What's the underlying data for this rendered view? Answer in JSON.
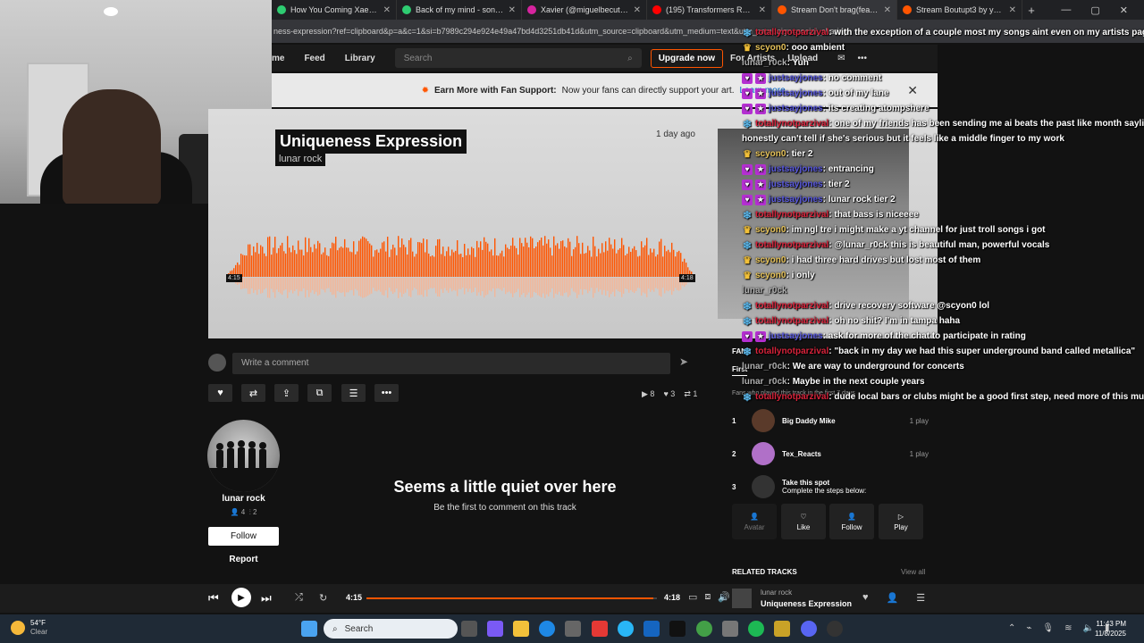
{
  "browser": {
    "tabs": [
      {
        "title": "How You Coming Xae? - so",
        "color": "#2ecc71"
      },
      {
        "title": "Back of my mind - song an",
        "color": "#2ecc71"
      },
      {
        "title": "Xavier (@miguelbecute) • In",
        "color": "#d6249f"
      },
      {
        "title": "(195) Transformers Reveng",
        "color": "#ff0000"
      },
      {
        "title": "Stream Don't brag(feat.DY",
        "color": "#ff5500"
      },
      {
        "title": "Stream Boutupt3 by young",
        "color": "#ff5500"
      }
    ],
    "new_tab": "+",
    "url": "ness-expression?ref=clipboard&p=a&c=1&si=b7989c294e924e49a47bd4d3251db41d&utm_source=clipboard&utm_medium=text&utm_campaign=social_sharing"
  },
  "site": {
    "nav": [
      "me",
      "Feed",
      "Library"
    ],
    "search_placeholder": "Search",
    "upgrade": "Upgrade now",
    "for_artists": "For Artists",
    "upload": "Upload",
    "banner_bold": "Earn More with Fan Support:",
    "banner_text": "Now your fans can directly support your art.",
    "banner_link": "Learn more."
  },
  "track": {
    "title": "Uniqueness Expression",
    "artist": "lunar rock",
    "posted": "1 day ago",
    "time_left": "4:15",
    "time_right": "4:18",
    "comment_placeholder": "Write a comment",
    "plays": "8",
    "likes": "3",
    "reposts": "1",
    "wave_color": "#ff5500"
  },
  "artist_panel": {
    "name": "lunar rock",
    "followers": "4",
    "tracks": "2",
    "follow": "Follow",
    "report": "Report"
  },
  "comments_empty": {
    "title": "Seems a little quiet over here",
    "subtitle": "Be the first to comment on this track"
  },
  "fans": {
    "title": "FANS",
    "tab": "First",
    "subtitle": "Fans who played this track in the first 7 days",
    "rows": [
      {
        "rank": "1",
        "name": "Big Daddy Mike",
        "plays": "1 play"
      },
      {
        "rank": "2",
        "name": "Tex_Reacts",
        "plays": "1 play"
      },
      {
        "rank": "3",
        "name": "Take this spot",
        "sub": "Complete the steps below:"
      }
    ],
    "spot_buttons": [
      "Avatar",
      "Like",
      "Follow",
      "Play"
    ],
    "related": "RELATED TRACKS",
    "view_all": "View all"
  },
  "chat": [
    {
      "badges": [
        "snow"
      ],
      "user": "totallynotparzival",
      "ucolor": "red",
      "msg": ": with the exception of a couple most my songs aint even on my artists pages"
    },
    {
      "badges": [
        "crown"
      ],
      "user": "scyon0",
      "ucolor": "gold",
      "msg": ": ooo ambient"
    },
    {
      "badges": [],
      "user": "lunar_r0ck",
      "ucolor": "grey",
      "msg": ": Yuh"
    },
    {
      "badges": [
        "heart",
        "star"
      ],
      "user": "justsayjones",
      "ucolor": "blue",
      "msg": ": no comment"
    },
    {
      "badges": [
        "heart",
        "star"
      ],
      "user": "justsayjones",
      "ucolor": "blue",
      "msg": ": out of my lane"
    },
    {
      "badges": [
        "heart",
        "star"
      ],
      "user": "justsayjones",
      "ucolor": "blue",
      "msg": ": its creating atompshere"
    },
    {
      "badges": [
        "snow"
      ],
      "user": "totallynotparzival",
      "ucolor": "red",
      "msg": ": one of my friends has been sending me ai beats the past like month sayling"
    },
    {
      "badges": [],
      "user": "",
      "ucolor": "grey",
      "msg": "honestly can't tell if she's serious but it feels like a middle finger to my work"
    },
    {
      "badges": [
        "crown"
      ],
      "user": "scyon0",
      "ucolor": "gold",
      "msg": ": tier 2"
    },
    {
      "badges": [
        "heart",
        "star"
      ],
      "user": "justsayjones",
      "ucolor": "blue",
      "msg": ": entrancing"
    },
    {
      "badges": [
        "heart",
        "star"
      ],
      "user": "justsayjones",
      "ucolor": "blue",
      "msg": ": tier 2"
    },
    {
      "badges": [
        "heart",
        "star"
      ],
      "user": "justsayjones",
      "ucolor": "blue",
      "msg": ": lunar rock tier 2"
    },
    {
      "badges": [
        "snow"
      ],
      "user": "totallynotparzival",
      "ucolor": "red",
      "msg": ": that bass is niceeee"
    },
    {
      "badges": [
        "crown"
      ],
      "user": "scyon0",
      "ucolor": "gold",
      "msg": ": im ngl tre i might make a yt channel for just troll songs i got"
    },
    {
      "badges": [
        "snow"
      ],
      "user": "totallynotparzival",
      "ucolor": "red",
      "msg": ": @lunar_r0ck this is beautiful man, powerful vocals"
    },
    {
      "badges": [
        "crown"
      ],
      "user": "scyon0",
      "ucolor": "gold",
      "msg": ": i had three hard drives but lost most of them"
    },
    {
      "badges": [
        "crown"
      ],
      "user": "scyon0",
      "ucolor": "gold",
      "msg": ": i only"
    },
    {
      "badges": [],
      "user": "lunar_r0ck",
      "ucolor": "grey",
      "msg": ""
    },
    {
      "badges": [
        "snow"
      ],
      "user": "totallynotparzival",
      "ucolor": "red",
      "msg": ": drive recovery software @scyon0 lol"
    },
    {
      "badges": [
        "snow"
      ],
      "user": "totallynotparzival",
      "ucolor": "red",
      "msg": ": oh no shit? I'm in tampa haha"
    },
    {
      "badges": [
        "heart",
        "star"
      ],
      "user": "justsayjones",
      "ucolor": "blue",
      "msg": ": ask for more of the chat to participate in rating"
    },
    {
      "badges": [
        "snow"
      ],
      "user": "totallynotparzival",
      "ucolor": "red",
      "msg": ": \"back in my day we had this super underground band called metallica\""
    },
    {
      "badges": [],
      "user": "lunar_r0ck",
      "ucolor": "grey",
      "msg": ": We are way to underground for concerts"
    },
    {
      "badges": [],
      "user": "lunar_r0ck",
      "ucolor": "grey",
      "msg": ": Maybe in the next couple years"
    },
    {
      "badges": [
        "snow"
      ],
      "user": "totallynotparzival",
      "ucolor": "red",
      "msg": ": dude local bars or clubs might be a good first step, need more of this mus"
    }
  ],
  "player": {
    "current": "4:15",
    "duration": "4:18",
    "progress": 0.988,
    "artist": "lunar rock",
    "title": "Uniqueness Expression"
  },
  "taskbar": {
    "temp": "54°F",
    "condition": "Clear",
    "search": "Search",
    "time": "11:43 PM",
    "date": "11/8/2025"
  }
}
